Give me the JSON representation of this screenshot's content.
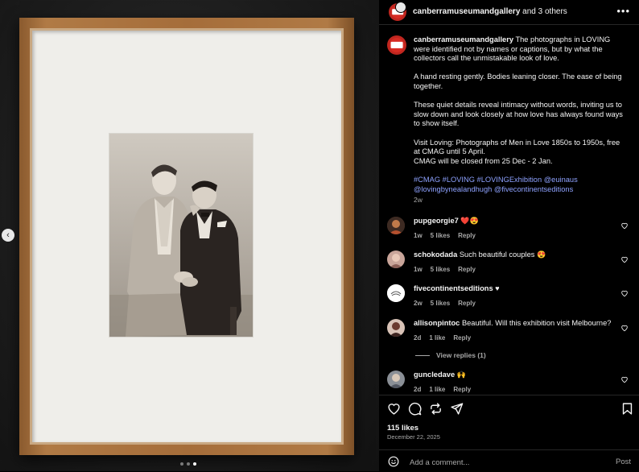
{
  "header": {
    "username": "canberramuseumandgallery",
    "collab_text": "and 3 others",
    "more_icon": "more-horizontal-icon"
  },
  "caption": {
    "username": "canberramuseumandgallery",
    "paragraph1": "The photographs in LOVING were identified not by names or captions, but by what the collectors call the unmistakable look of love.",
    "paragraph2": "A hand resting gently. Bodies leaning closer. The ease of being together.",
    "paragraph3": "These quiet details reveal intimacy without words, inviting us to slow down and look closely at how love has always found ways to show itself.",
    "paragraph4": "Visit Loving: Photographs of Men in Love 1850s to 1950s, free at CMAG until 5 April.\nCMAG will be closed from 25 Dec - 2 Jan.",
    "tags": "#CMAG #LOVING #LOVINGExhibition @euinaus @lovingbynealandhugh @fivecontinentseditions",
    "time": "2w"
  },
  "comments": [
    {
      "username": "pupgeorgie7",
      "text": "",
      "emoji": "❤️😍",
      "time": "1w",
      "likes": "5 likes",
      "reply": "Reply"
    },
    {
      "username": "schokodada",
      "text": "Such beautiful couples",
      "emoji": "😍",
      "time": "1w",
      "likes": "5 likes",
      "reply": "Reply"
    },
    {
      "username": "fivecontinentseditions",
      "text": "",
      "emoji": "♥",
      "time": "2w",
      "likes": "5 likes",
      "reply": "Reply"
    },
    {
      "username": "allisonpintoc",
      "text": "Beautiful. Will this exhibition visit Melbourne?",
      "emoji": "",
      "time": "2d",
      "likes": "1 like",
      "reply": "Reply"
    },
    {
      "username": "guncledave",
      "text": "",
      "emoji": "🙌",
      "time": "2d",
      "likes": "1 like",
      "reply": "Reply"
    }
  ],
  "view_replies": "View replies (1)",
  "engagement": {
    "likes": "115 likes",
    "date": "December 22, 2025"
  },
  "composer": {
    "placeholder": "Add a comment...",
    "post_label": "Post"
  },
  "carousel": {
    "current": 3,
    "total": 3
  },
  "colors": {
    "accent_link": "#8ea2ff",
    "brand_red": "#d72c24",
    "secondary_text": "#a8a8a8"
  }
}
